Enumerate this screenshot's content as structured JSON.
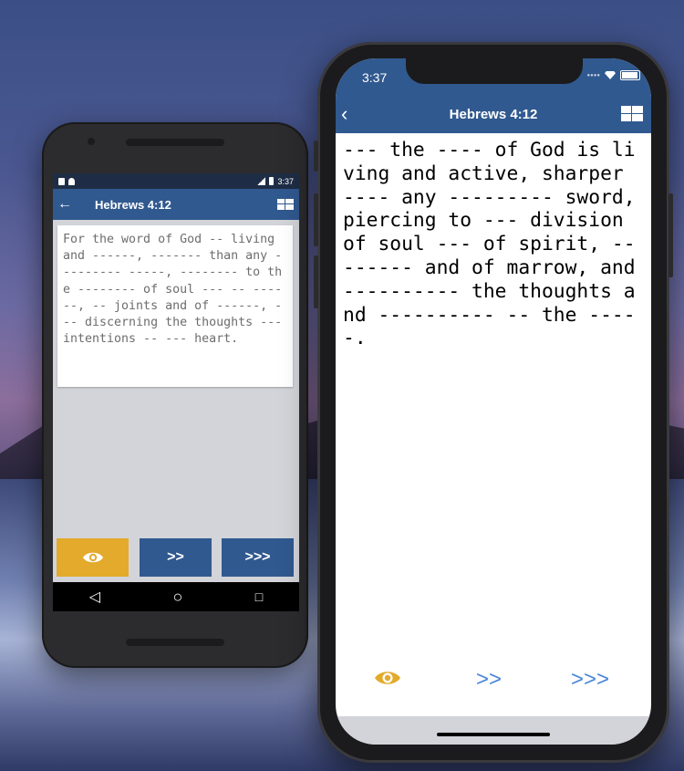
{
  "android": {
    "status_time": "3:37",
    "title": "Hebrews 4:12",
    "back_icon": "←",
    "verse_text": "For the word of God -- living and ------, ------- than any --------- -----, -------- to the -------- of soul --- -- ------, -- joints and of ------, --- discerning the thoughts --- intentions -- --- heart.",
    "buttons": {
      "reveal_icon": "eye-icon",
      "next_label": ">>",
      "skip_label": ">>>"
    },
    "nav": {
      "back": "◁",
      "home": "○",
      "recents": "□"
    },
    "colors": {
      "toolbar": "#30598f",
      "reveal": "#e3aa2b",
      "buttons": "#30598f"
    }
  },
  "iphone": {
    "status_time": "3:37",
    "title": "Hebrews 4:12",
    "back_icon": "‹",
    "verse_text": "--- the ---- of God is living and active, sharper ---- any --------- sword, piercing to --- division of soul --- of spirit, -- ------ and of marrow, and ---------- the thoughts and ---------- -- the -----.",
    "buttons": {
      "reveal_icon": "eye-icon",
      "next_label": ">>",
      "skip_label": ">>>"
    },
    "colors": {
      "header": "#30598f",
      "reveal": "#e3aa2b",
      "link": "#4a86d8"
    }
  }
}
